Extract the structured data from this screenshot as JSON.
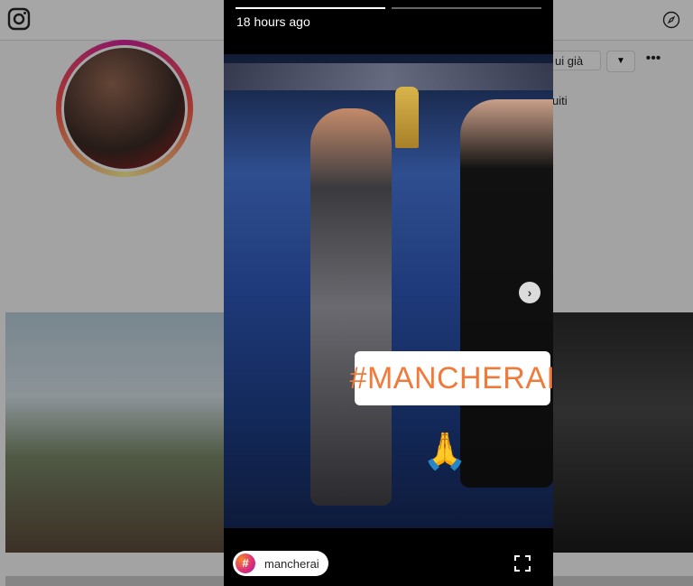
{
  "profile_page": {
    "follow_button": "ui già",
    "dropdown_icon": "caret-down-icon",
    "more_button": "•••",
    "followed_text": "uiti"
  },
  "story": {
    "timestamp": "18 hours ago",
    "hashtag_sticker": "#MANCHERAI",
    "emoji": "🙏",
    "next_button": "›",
    "tag_pill": {
      "icon": "#",
      "label": "mancherai"
    }
  },
  "colors": {
    "hashtag_orange": "#f07a3a",
    "story_background": "#000000"
  }
}
